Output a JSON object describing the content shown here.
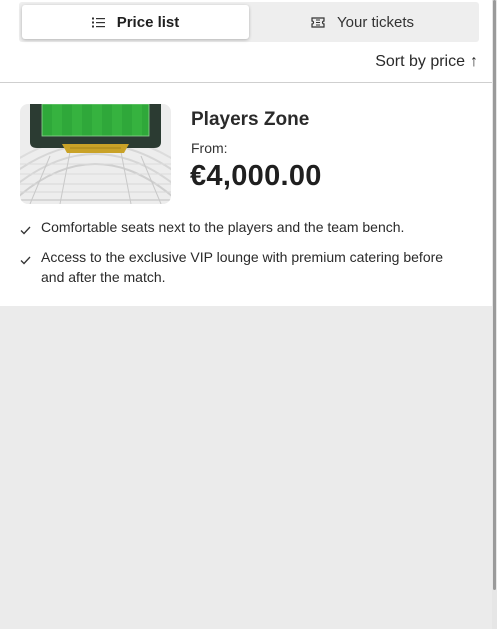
{
  "tabs": [
    {
      "label": "Price list",
      "icon": "list-icon",
      "active": true
    },
    {
      "label": "Your tickets",
      "icon": "ticket-icon",
      "active": false
    }
  ],
  "sort": {
    "label": "Sort by price",
    "arrow": "↑"
  },
  "product": {
    "title": "Players Zone",
    "from_label": "From:",
    "price": "€4,000.00",
    "image_icon": "stadium-seating-map",
    "features": [
      "Comfortable seats next to the players and the team bench.",
      "Access to the exclusive VIP lounge with premium catering before and after the match."
    ]
  },
  "colors": {
    "pitch": "#2fa83a",
    "highlight_seats": "#c9a227",
    "background": "#ebebeb"
  }
}
